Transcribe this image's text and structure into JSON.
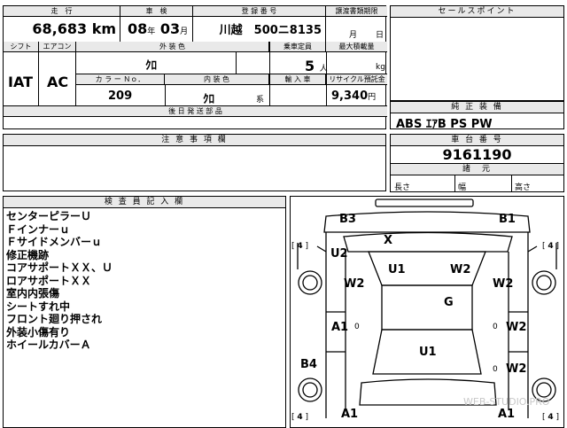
{
  "top": {
    "mileage_label": "走　行",
    "mileage": "68,683",
    "mileage_unit": "km",
    "inspection_label": "車　検",
    "inspection_year": "08",
    "inspection_year_unit": "年",
    "inspection_month": "03",
    "inspection_month_unit": "月",
    "plate_label": "登 録 番 号",
    "plate": "川越　500ニ8135",
    "transfer_label": "譲渡書類期限",
    "transfer_month": "月",
    "transfer_day": "日"
  },
  "row2": {
    "shift_label": "シフト",
    "shift": "IAT",
    "aircon_label": "エアコン",
    "aircon": "AC",
    "exterior_label": "外 装 色",
    "exterior": "ｸﾛ",
    "capacity_label": "乗車定員",
    "capacity": "5",
    "capacity_unit": "人",
    "maxload_label": "最大積載量",
    "maxload_unit": "kg",
    "colorno_label": "カ ラ ー Ｎｏ．",
    "colorno": "209",
    "interior_label": "内 装 色",
    "interior": "ｸﾛ",
    "interior_unit": "系",
    "import_label": "輸 入 車",
    "recycle_label": "リサイクル預託金",
    "recycle": "9,340",
    "recycle_unit": "円"
  },
  "parts": {
    "label": "後 日 発 送 部 品"
  },
  "sales": {
    "label": "セールスポイント"
  },
  "equipment": {
    "label": "純 正 装 備",
    "value": "ABS ｴｱB PS PW"
  },
  "caution": {
    "label": "注 意 事 項 欄"
  },
  "chassis": {
    "label": "車 台 番 号",
    "value": "9161190"
  },
  "dims": {
    "label": "諸　元",
    "length": "長さ",
    "width": "幅",
    "height": "高さ"
  },
  "inspector": {
    "label": "検 査 員 記 入 欄",
    "lines": [
      "センターピラーＵ",
      "Ｆインナーｕ",
      "Ｆサイドメンバーｕ",
      "修正機跡",
      "コアサポートＸＸ、Ｕ",
      "ロアサポートＸＸ",
      "室内内張傷",
      "シートすれ中",
      "フロント廻り押され",
      "外装小傷有り",
      "ホイールカバーＡ"
    ]
  },
  "diagram": {
    "marks": [
      "B3",
      "B1",
      "X",
      "U2",
      "U1",
      "W2",
      "W2",
      "W2",
      "G",
      "A1",
      "W2",
      "U1",
      "B4",
      "W2",
      "A1",
      "A1"
    ],
    "tire": "4",
    "zero": "0",
    "watermark": "WEB-STUDIO.PRO"
  }
}
